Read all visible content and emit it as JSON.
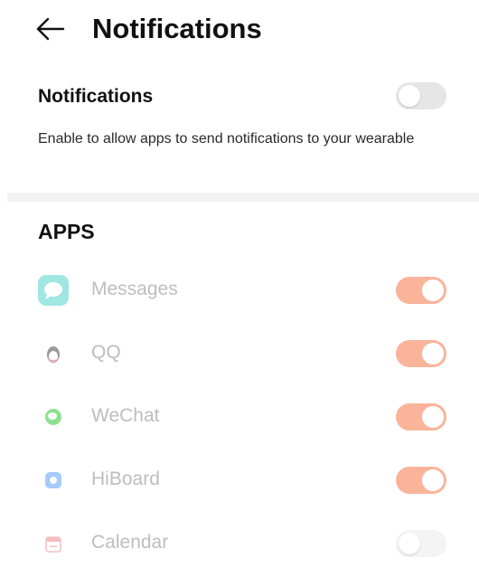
{
  "header": {
    "title": "Notifications",
    "back_icon": "arrow-left-icon"
  },
  "master": {
    "label": "Notifications",
    "enabled": false,
    "description": "Enable to allow apps to send notifications to your wearable"
  },
  "apps_section": {
    "title": "APPS",
    "items": [
      {
        "label": "Messages",
        "icon": "messages-icon",
        "enabled": true
      },
      {
        "label": "QQ",
        "icon": "qq-icon",
        "enabled": true
      },
      {
        "label": "WeChat",
        "icon": "wechat-icon",
        "enabled": true
      },
      {
        "label": "HiBoard",
        "icon": "hiboard-icon",
        "enabled": true
      },
      {
        "label": "Calendar",
        "icon": "calendar-icon",
        "enabled": false
      }
    ]
  },
  "colors": {
    "toggle_on": "#f9b49a",
    "toggle_off": "#e6e6e6",
    "disabled_text": "#bdbdbd"
  }
}
